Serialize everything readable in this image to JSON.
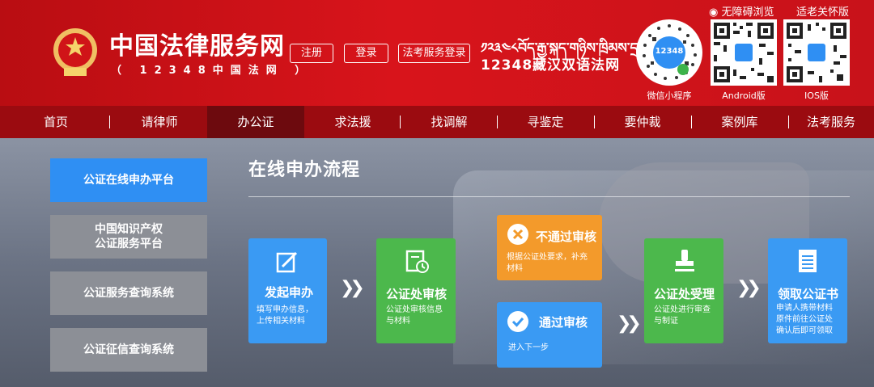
{
  "header": {
    "site_title": "中国法律服务网",
    "site_subtitle": "（ 12348中国法网 ）",
    "register": "注册",
    "login": "登录",
    "exam_login": "法考服务登录",
    "tibetan_title": "༡༢༣༤༨བོད་རྒྱ་སྐད་གཉིས་ཁྲིམས་དྲ།",
    "tibetan_cn": "12348藏汉双语法网",
    "accessible": "无障碍浏览",
    "elder": "适老关怀版",
    "qr": [
      {
        "label": "微信小程序"
      },
      {
        "label": "Android版"
      },
      {
        "label": "IOS版"
      }
    ],
    "mini_badge": "12348"
  },
  "nav": {
    "items": [
      {
        "label": "首页"
      },
      {
        "label": "请律师"
      },
      {
        "label": "办公证"
      },
      {
        "label": "求法援"
      },
      {
        "label": "找调解"
      },
      {
        "label": "寻鉴定"
      },
      {
        "label": "要仲裁"
      },
      {
        "label": "案例库"
      },
      {
        "label": "法考服务"
      }
    ],
    "active": "办公证"
  },
  "sidebar": {
    "items": [
      {
        "label": "公证在线申办平台"
      },
      {
        "label": "中国知识产权\n公证服务平台"
      },
      {
        "label": "公证服务查询系统"
      },
      {
        "label": "公证征信查询系统"
      }
    ]
  },
  "flow": {
    "title": "在线申办流程",
    "steps": {
      "apply": {
        "title": "发起申办",
        "desc": "填写申办信息，\n上传相关材料"
      },
      "review": {
        "title": "公证处审核",
        "desc": "公证处审核信息\n与材料"
      },
      "reject": {
        "title": "不通过审核",
        "desc": "根据公证处要求，补充\n材料"
      },
      "pass": {
        "title": "通过审核",
        "desc": "进入下一步"
      },
      "accept": {
        "title": "公证处受理",
        "desc": "公证处进行审查\n与制证"
      },
      "collect": {
        "title": "领取公证书",
        "desc": "申请人携带材料\n原件前往公证处\n确认后即可领取"
      }
    }
  },
  "colors": {
    "header_red": "#d8141b",
    "nav_red": "#9b0b10",
    "blue": "#2f8ff3",
    "green": "#4cb84c",
    "orange": "#f39a2b",
    "grey": "#8c8f96"
  }
}
